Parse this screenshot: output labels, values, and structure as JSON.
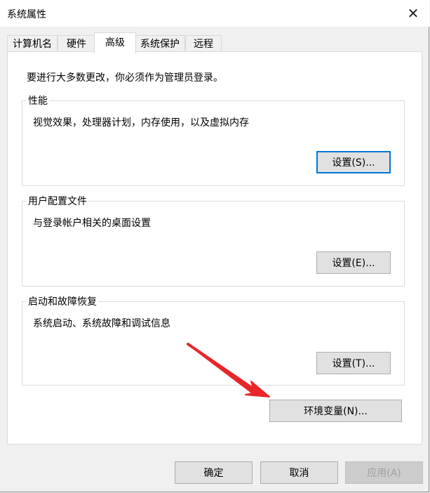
{
  "window": {
    "title": "系统属性",
    "close_glyph": "✕"
  },
  "tabs": [
    {
      "label": "计算机名"
    },
    {
      "label": "硬件"
    },
    {
      "label": "高级",
      "active": true
    },
    {
      "label": "系统保护"
    },
    {
      "label": "远程"
    }
  ],
  "admin_note": "要进行大多数更改，你必须作为管理员登录。",
  "groups": {
    "performance": {
      "title": "性能",
      "desc": "视觉效果，处理器计划，内存使用，以及虚拟内存",
      "button": "设置(S)..."
    },
    "profile": {
      "title": "用户配置文件",
      "desc": "与登录帐户相关的桌面设置",
      "button": "设置(E)..."
    },
    "startup": {
      "title": "启动和故障恢复",
      "desc": "系统启动、系统故障和调试信息",
      "button": "设置(T)..."
    }
  },
  "env_button": "环境变量(N)...",
  "footer": {
    "ok": "确定",
    "cancel": "取消",
    "apply": "应用(A)"
  },
  "colors": {
    "focus": "#0078d7",
    "arrow": "#e8262a"
  }
}
